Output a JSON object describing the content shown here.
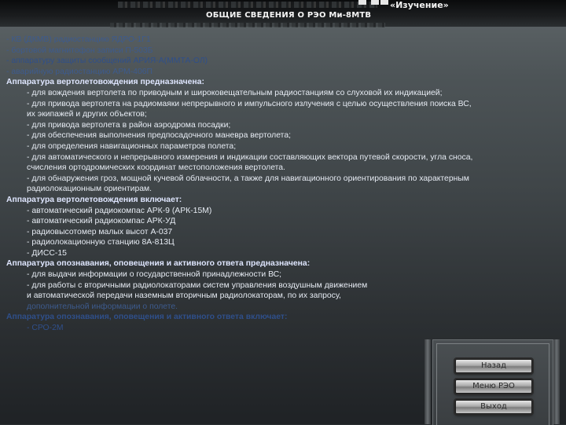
{
  "header": {
    "mode_label": "«Изучение»",
    "title": "ОБЩИЕ СВЕДЕНИЯ О РЭО Ми-8МТВ"
  },
  "body_lines": [
    {
      "text": "- КВ (ДКМВ) радиостанцию ЯДРО-1Г1",
      "kind": "faded"
    },
    {
      "text": "- бортовой магнитофон записи П-503Б",
      "kind": "faded"
    },
    {
      "text": "- аппаратуру защиты сообщений АРИЯ-А(ММТА-ОЛ)",
      "kind": "faded2"
    },
    {
      "text": "- аварийную радиостанцию АРМ-406П",
      "kind": "faded"
    },
    {
      "text": "Аппаратура вертолетовождения предназначена:",
      "kind": "heading"
    },
    {
      "text": "- для вождения вертолета по приводным и широковещательным радиостанциям  со слуховой их индикацией;",
      "kind": "indent"
    },
    {
      "text": "- для привода вертолета на радиомаяки непрерывного и импульсного излучения с целью осуществления поиска ВС,",
      "kind": "indent"
    },
    {
      "text": "их экипажей и других объектов;",
      "kind": "indent"
    },
    {
      "text": "- для привода вертолета в район аэродрома посадки;",
      "kind": "indent"
    },
    {
      "text": "- для обеспечения выполнения предпосадочного маневра вертолета;",
      "kind": "indent"
    },
    {
      "text": "- для определения навигационных параметров полета;",
      "kind": "indent"
    },
    {
      "text": "- для автоматического и непрерывного измерения и индикации составляющих вектора путевой скорости, угла сноса,",
      "kind": "indent"
    },
    {
      "text": "счисления ортодромических координат местоположения вертолета.",
      "kind": "indent"
    },
    {
      "text": "- для обнаружения гроз, мощной кучевой облачности, а также для навигационного ориентирования по характерным",
      "kind": "indent"
    },
    {
      "text": "радиолокационным ориентирам.",
      "kind": "indent"
    },
    {
      "text": "Аппаратура вертолетовождения включает:",
      "kind": "heading"
    },
    {
      "text": "-  автоматический радиокомпас АРК-9 (АРК-15М)",
      "kind": "indent"
    },
    {
      "text": "-  автоматический радиокомпас  АРК-УД",
      "kind": "indent"
    },
    {
      "text": "-  радиовысотомер малых высот  А-037",
      "kind": "indent"
    },
    {
      "text": "-  радиолокационную станцию 8А-813Ц",
      "kind": "indent"
    },
    {
      "text": "-  ДИСС-15",
      "kind": "indent"
    },
    {
      "text": "Аппаратура опознавания, оповещения и активного ответа предназначена:",
      "kind": "heading"
    },
    {
      "text": "- для выдачи информации о государственной принадлежности ВС;",
      "kind": "indent"
    },
    {
      "text": "- для работы с вторичными радиолокаторами систем управления воздушным движением",
      "kind": "indent"
    },
    {
      "text": "и автоматической передачи наземным вторичным радиолокаторам, по их запросу,",
      "kind": "indent"
    },
    {
      "text": "дополнительной информации о полете.",
      "kind": "indent faded"
    },
    {
      "text": "Аппаратура опознавания, оповещения и активного ответа включает:",
      "kind": "heading faded2"
    },
    {
      "text": "- СРО-2М",
      "kind": "indent faded2"
    }
  ],
  "nav": {
    "buttons": [
      "Назад",
      "Меню РЭО",
      "Выход"
    ]
  },
  "colors": {
    "text": "#e6ebf3",
    "heading": "#dfe6ff",
    "faded": "#3d5b8e"
  }
}
